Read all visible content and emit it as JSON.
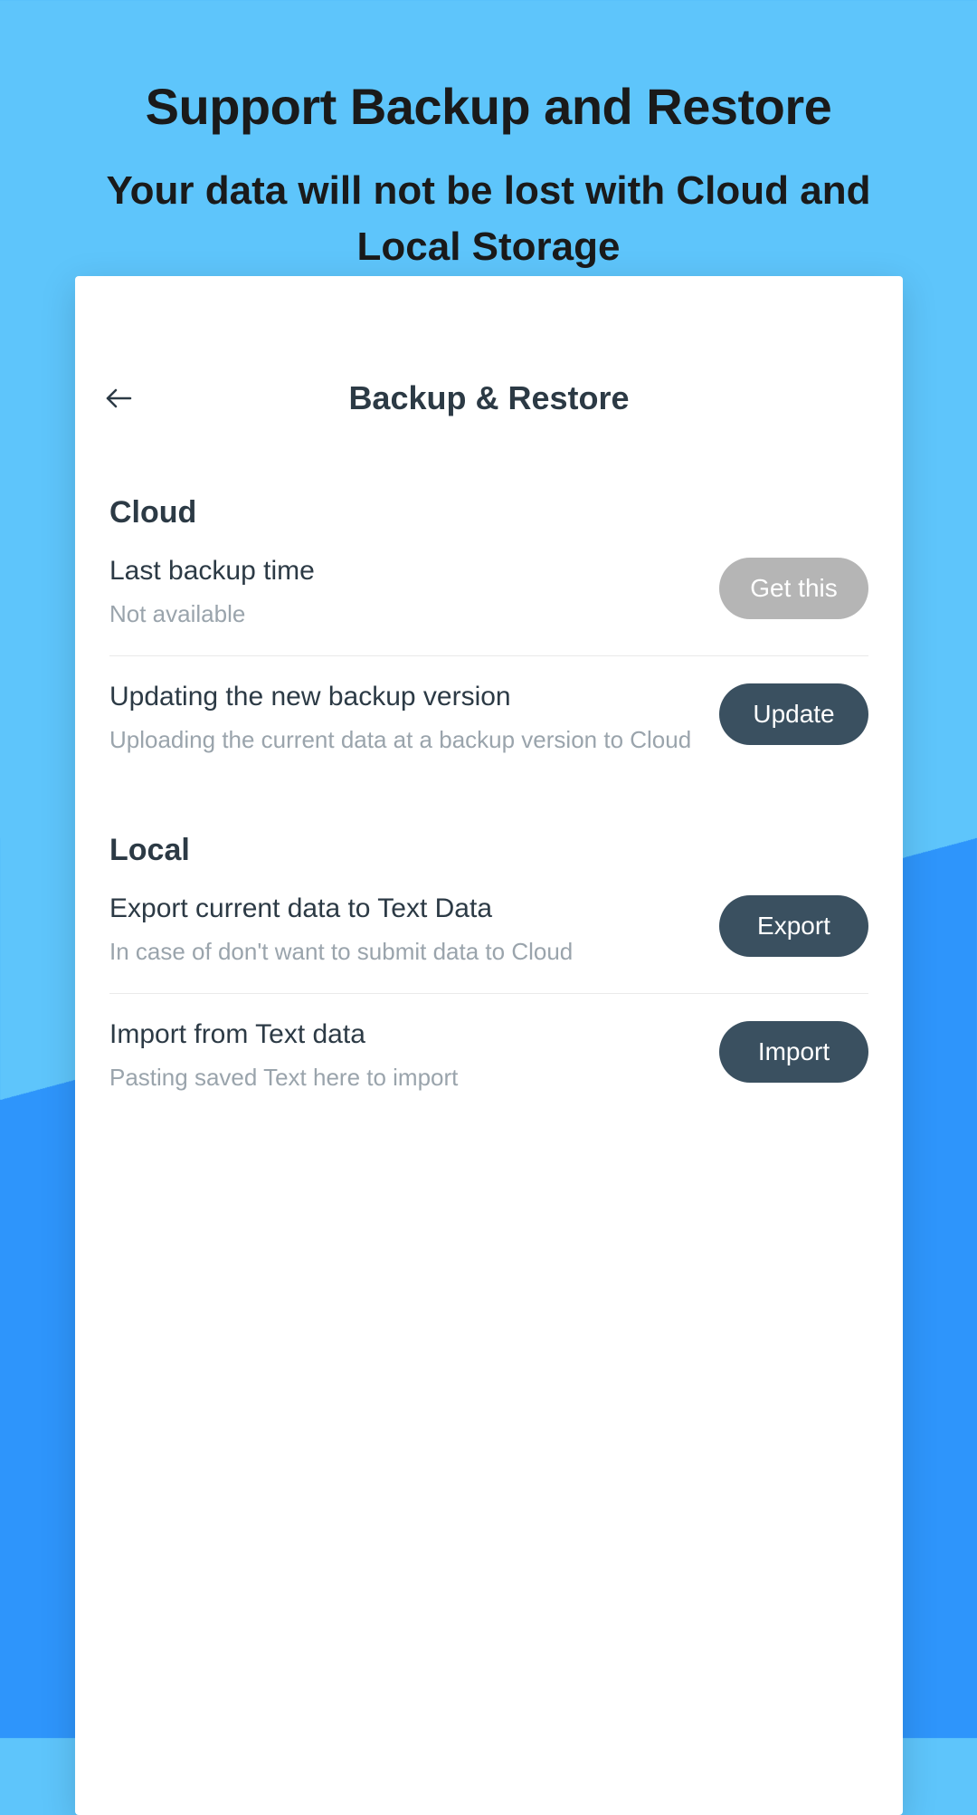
{
  "promo": {
    "title": "Support Backup and Restore",
    "subtitle": "Your data will not be lost with Cloud and Local Storage"
  },
  "app": {
    "header_title": "Backup & Restore",
    "sections": {
      "cloud": {
        "title": "Cloud",
        "items": [
          {
            "label": "Last backup time",
            "description": "Not available",
            "button_label": "Get this",
            "button_state": "disabled"
          },
          {
            "label": "Updating the new backup version",
            "description": "Uploading the current data at a backup version to Cloud",
            "button_label": "Update",
            "button_state": "primary"
          }
        ]
      },
      "local": {
        "title": "Local",
        "items": [
          {
            "label": "Export current data to Text Data",
            "description": "In case of don't want to submit data to Cloud",
            "button_label": "Export",
            "button_state": "primary"
          },
          {
            "label": "Import from Text data",
            "description": "Pasting saved Text here to import",
            "button_label": "Import",
            "button_state": "primary"
          }
        ]
      }
    }
  }
}
